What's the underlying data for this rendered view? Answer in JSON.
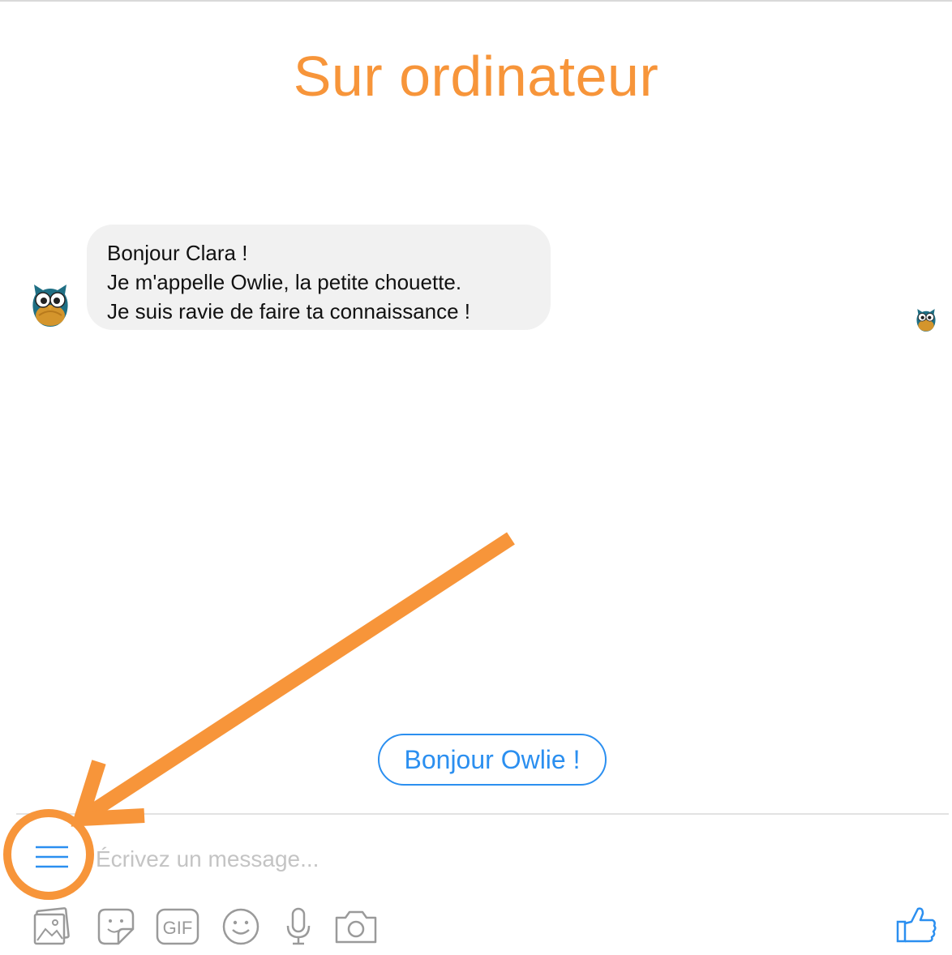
{
  "header": {
    "title": "Sur ordinateur"
  },
  "conversation": {
    "messages": [
      {
        "sender": "Owlie",
        "lines": [
          "Bonjour Clara !",
          "Je m'appelle Owlie, la petite chouette.",
          "Je suis ravie de faire ta connaissance !"
        ]
      }
    ],
    "quick_replies": [
      {
        "label": "Bonjour Owlie !"
      }
    ]
  },
  "composer": {
    "placeholder": "Écrivez un message...",
    "value": "",
    "toolbar_icons": [
      "photo-icon",
      "sticker-icon",
      "gif-icon",
      "emoji-icon",
      "microphone-icon",
      "camera-icon"
    ],
    "gif_label": "GIF",
    "like_icon": "thumbs-up-icon",
    "menu_icon": "menu-icon"
  },
  "annotation": {
    "highlight": "menu-icon",
    "color": "#f7953a"
  },
  "colors": {
    "title": "#f7953a",
    "accent": "#2b8ff0",
    "bubble": "#f1f1f1",
    "toolbar_icons": "#9a9a9a"
  }
}
